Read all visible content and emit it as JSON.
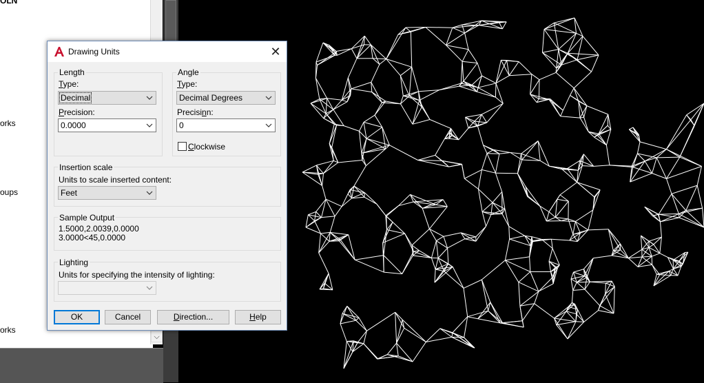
{
  "left_panel": {
    "fragments": [
      "OLN",
      "orks",
      "oups",
      "orks"
    ]
  },
  "dialog": {
    "title": "Drawing Units",
    "length": {
      "group_label": "Length",
      "type_label": "Type:",
      "type_value": "Decimal",
      "precision_label": "Precision:",
      "precision_value": "0.0000"
    },
    "angle": {
      "group_label": "Angle",
      "type_label": "Type:",
      "type_value": "Decimal Degrees",
      "precision_label": "Precision:",
      "precision_value": "0",
      "clockwise_label": "Clockwise",
      "clockwise_checked": false
    },
    "insertion": {
      "group_label": "Insertion scale",
      "prompt": "Units to scale inserted content:",
      "value": "Feet"
    },
    "sample": {
      "group_label": "Sample Output",
      "line1": "1.5000,2.0039,0.0000",
      "line2": "3.0000<45,0.0000"
    },
    "lighting": {
      "group_label": "Lighting",
      "prompt": "Units for specifying the intensity of lighting:",
      "value": ""
    },
    "buttons": {
      "ok": "OK",
      "cancel": "Cancel",
      "direction": "Direction...",
      "help": "Help"
    }
  },
  "colors": {
    "accent": "#0078d7",
    "canvas_bg": "#000000",
    "mesh_stroke": "#ffffff",
    "logo_red": "#c8102e"
  }
}
